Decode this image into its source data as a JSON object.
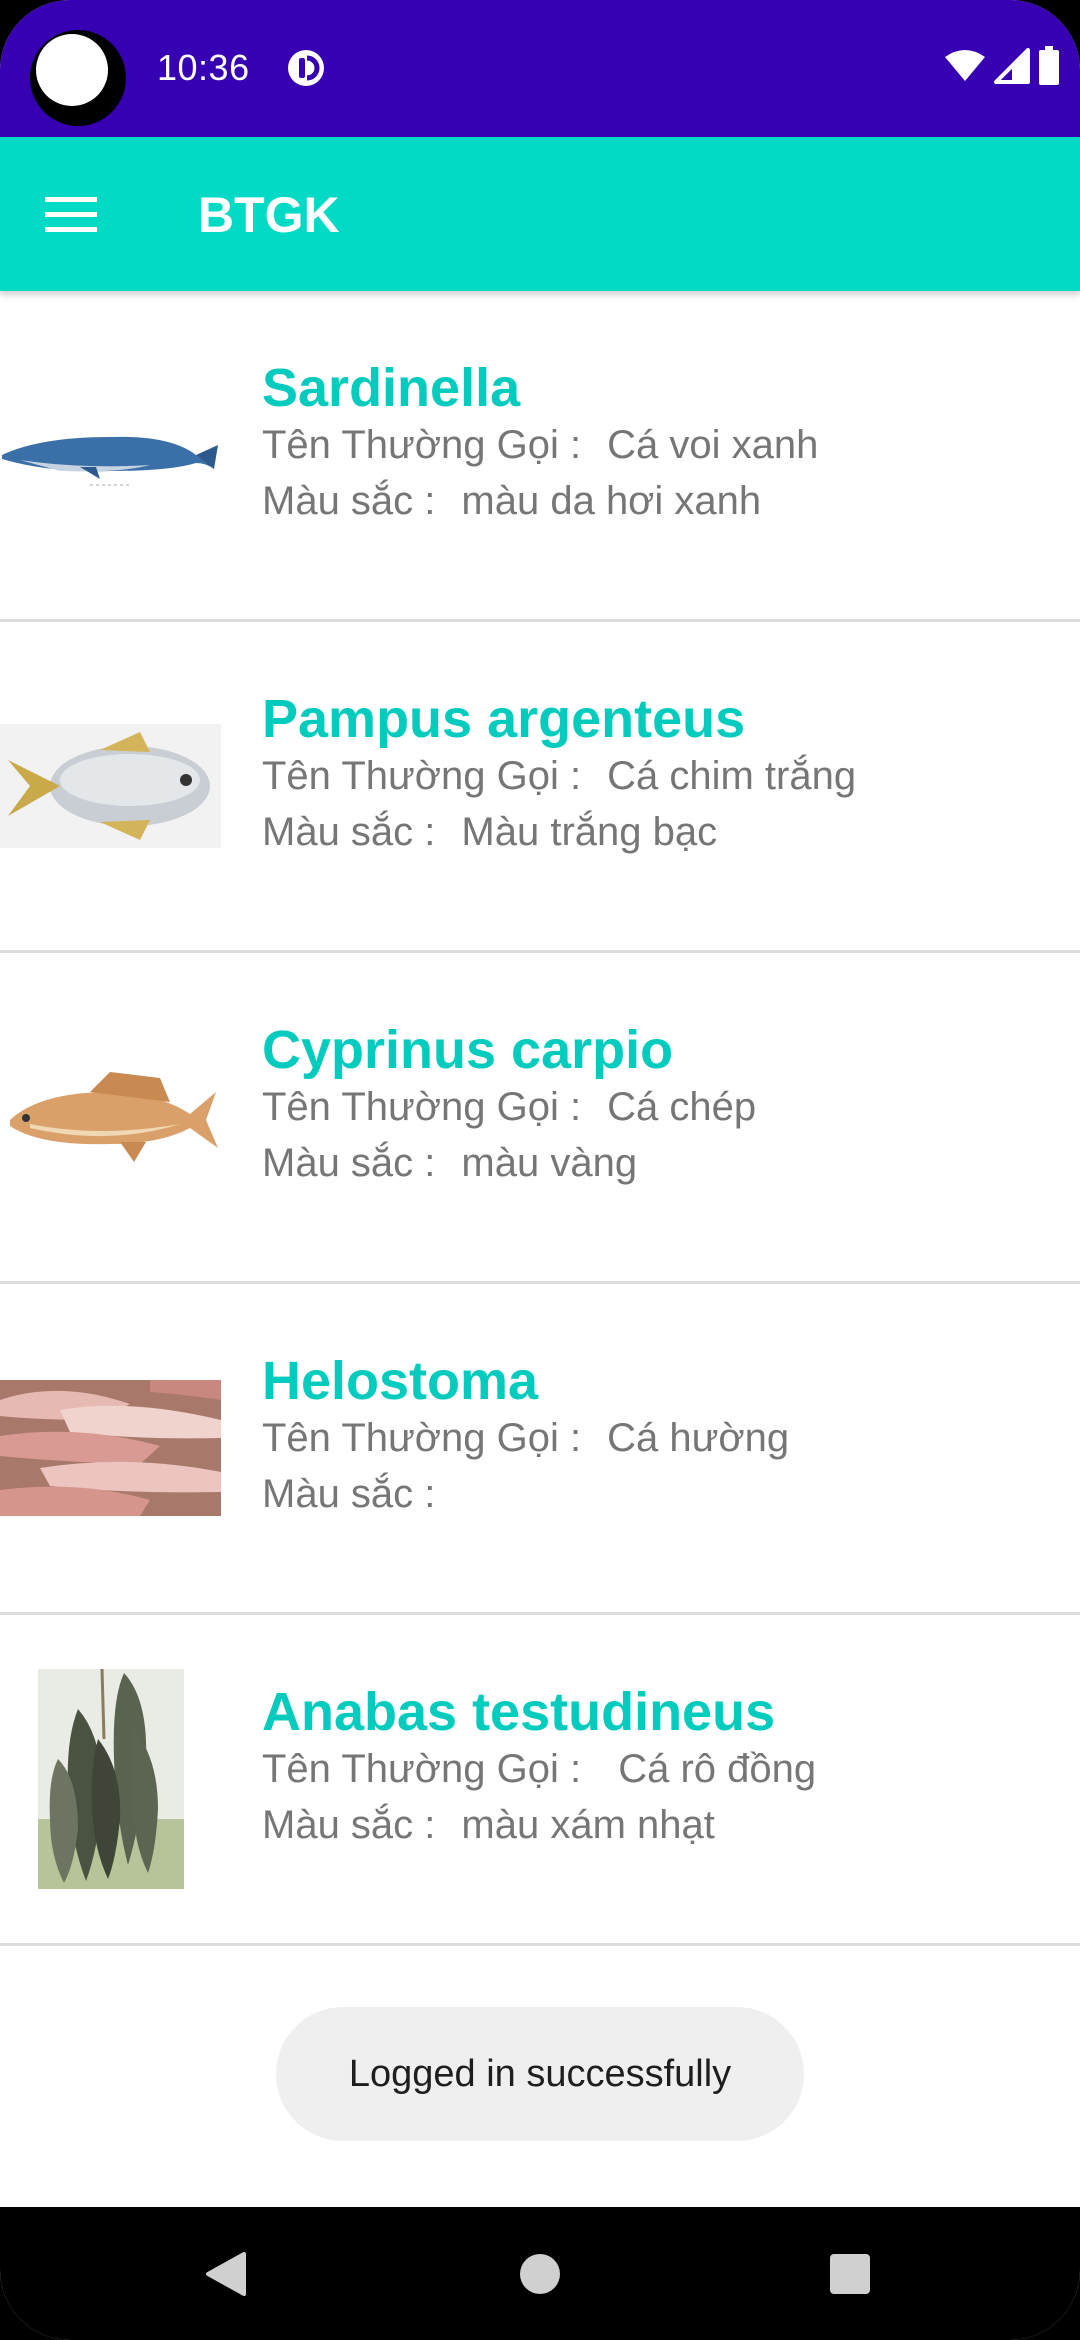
{
  "status_bar": {
    "time": "10:36",
    "notification_icon": "data-saver-icon",
    "icons": [
      "wifi-icon",
      "signal-icon",
      "battery-icon"
    ],
    "background": "#3700b3"
  },
  "app_bar": {
    "title": "BTGK",
    "menu_icon": "hamburger-menu-icon",
    "background": "#03dac5"
  },
  "list": {
    "items": [
      {
        "scientific_name": "Sardinella",
        "common_label": "Tên Thường Gọi :",
        "common_name": "Cá voi xanh",
        "color_label": "Màu sắc :",
        "color": "màu da hơi xanh",
        "image": "blue-whale-image"
      },
      {
        "scientific_name": "Pampus argenteus",
        "common_label": "Tên Thường Gọi :",
        "common_name": "Cá chim trắng",
        "color_label": "Màu sắc :",
        "color": "Màu trắng bạc",
        "image": "silver-pomfret-image"
      },
      {
        "scientific_name": "Cyprinus carpio",
        "common_label": "Tên Thường Gọi :",
        "common_name": "Cá chép",
        "color_label": "Màu sắc :",
        "color": "màu vàng",
        "image": "carp-image"
      },
      {
        "scientific_name": "Helostoma",
        "common_label": "Tên Thường Gọi :",
        "common_name": "Cá hường",
        "color_label": "Màu sắc :",
        "color": "",
        "image": "pink-fish-pile-image"
      },
      {
        "scientific_name": "Anabas testudineus",
        "common_label": "Tên Thường Gọi :",
        "common_name": " Cá rô đồng",
        "color_label": "Màu sắc :",
        "color": "màu xám nhạt",
        "image": "climbing-perch-image"
      }
    ],
    "name_color": "#03cbbd"
  },
  "toast": {
    "message": "Logged in successfully"
  },
  "nav_bar": {
    "buttons": [
      "back-icon",
      "home-icon",
      "recents-icon"
    ]
  }
}
